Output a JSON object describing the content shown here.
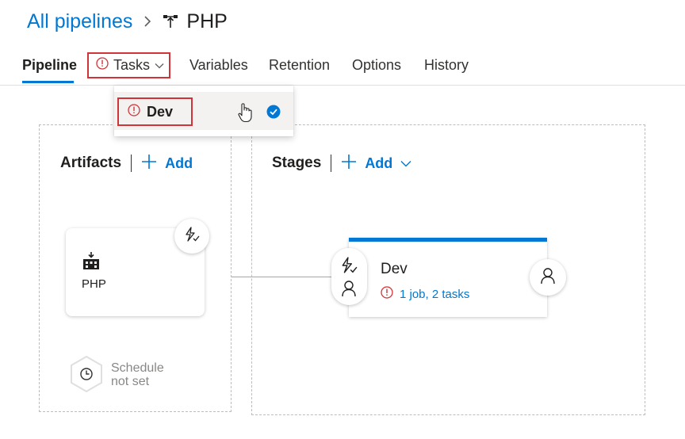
{
  "breadcrumb": {
    "root_label": "All pipelines",
    "title": "PHP"
  },
  "tabs": [
    {
      "label": "Pipeline",
      "active": true
    },
    {
      "label": "Tasks",
      "has_error": true,
      "has_dropdown": true
    },
    {
      "label": "Variables"
    },
    {
      "label": "Retention"
    },
    {
      "label": "Options"
    },
    {
      "label": "History"
    }
  ],
  "tasks_dropdown": {
    "items": [
      {
        "label": "Dev",
        "has_error": true,
        "selected": true
      }
    ]
  },
  "artifacts": {
    "title": "Artifacts",
    "add_label": "Add",
    "items": [
      {
        "name": "PHP"
      }
    ],
    "schedule": {
      "line1": "Schedule",
      "line2": "not set"
    }
  },
  "stages": {
    "title": "Stages",
    "add_label": "Add",
    "items": [
      {
        "name": "Dev",
        "status": "1 job, 2 tasks",
        "has_error": true
      }
    ]
  },
  "colors": {
    "accent": "#0078d4",
    "error": "#d13438",
    "text": "#323130",
    "muted": "#8a8886"
  }
}
